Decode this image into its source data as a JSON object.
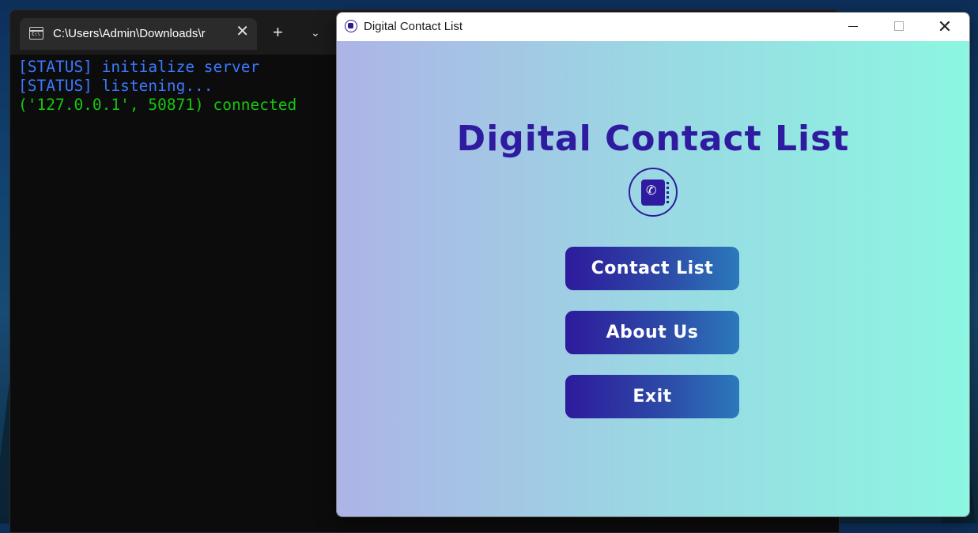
{
  "terminal": {
    "tab_title": "C:\\Users\\Admin\\Downloads\\r",
    "close_glyph": "✕",
    "new_tab_glyph": "+",
    "dropdown_glyph": "⌄",
    "lines": [
      {
        "text": "[STATUS] initialize server",
        "color": "#3b78ff"
      },
      {
        "text": "[STATUS] listening...",
        "color": "#3b78ff"
      },
      {
        "text": "('127.0.0.1', 50871) connected",
        "color": "#16c60c"
      }
    ]
  },
  "app": {
    "window_title": "Digital Contact List",
    "heading": "Digital Contact List",
    "logo_icon": "contact-book-icon",
    "buttons": {
      "contact_list": "Contact List",
      "about_us": "About Us",
      "exit": "Exit"
    },
    "colors": {
      "accent": "#2f1ba0",
      "gradient_left": "#adb4e6",
      "gradient_right": "#8cf6e2"
    }
  }
}
